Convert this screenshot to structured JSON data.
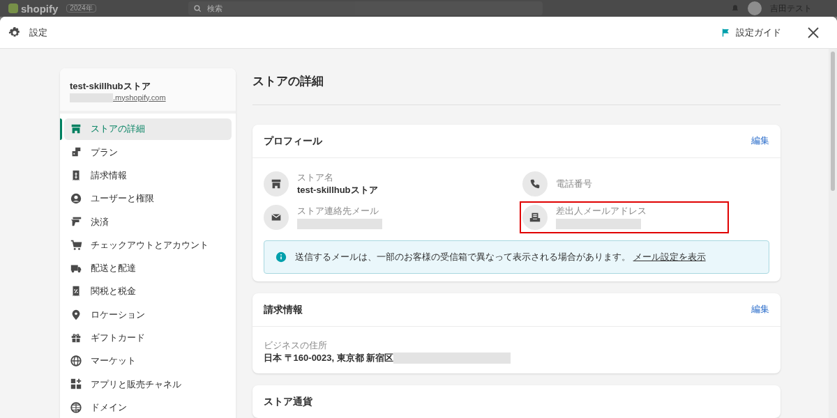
{
  "topbar": {
    "logo": "shopify",
    "badge": "2024年",
    "search": {
      "placeholder": "検索"
    },
    "user": "吉田テスト"
  },
  "window": {
    "title": "設定",
    "guide": "設定ガイド"
  },
  "sidebar": {
    "store_name": "test-skillhubストア",
    "domain": ".myshopify.com",
    "items": [
      {
        "label": "ストアの詳細",
        "kind": "store",
        "selected": true
      },
      {
        "label": "プラン",
        "kind": "plan",
        "selected": false
      },
      {
        "label": "請求情報",
        "kind": "bill",
        "selected": false
      },
      {
        "label": "ユーザーと権限",
        "kind": "user",
        "selected": false
      },
      {
        "label": "決済",
        "kind": "card",
        "selected": false
      },
      {
        "label": "チェックアウトとアカウント",
        "kind": "cart",
        "selected": false
      },
      {
        "label": "配送と配達",
        "kind": "truck",
        "selected": false
      },
      {
        "label": "関税と税金",
        "kind": "tax",
        "selected": false
      },
      {
        "label": "ロケーション",
        "kind": "pin",
        "selected": false
      },
      {
        "label": "ギフトカード",
        "kind": "gift",
        "selected": false
      },
      {
        "label": "マーケット",
        "kind": "globe",
        "selected": false
      },
      {
        "label": "アプリと販売チャネル",
        "kind": "apps",
        "selected": false
      },
      {
        "label": "ドメイン",
        "kind": "domain",
        "selected": false
      }
    ]
  },
  "page": {
    "title": "ストアの詳細",
    "profile": {
      "title": "プロフィール",
      "edit": "編集",
      "fields": [
        {
          "label": "ストア名",
          "value": "test-skillhubストア",
          "kind": "store",
          "highlighted": false
        },
        {
          "label": "電話番号",
          "kind": "phone",
          "highlighted": false
        },
        {
          "label": "ストア連絡先メール",
          "redacted": true,
          "kind": "mail",
          "highlighted": false
        },
        {
          "label": "差出人メールアドレス",
          "redacted": true,
          "kind": "sender",
          "highlighted": true
        }
      ],
      "notice": {
        "text": "送信するメールは、一部のお客様の受信箱で異なって表示される場合があります。",
        "link": "メール設定を表示"
      }
    },
    "billing": {
      "title": "請求情報",
      "edit": "編集",
      "address_label": "ビジネスの住所",
      "address": "日本 〒160-0023, 東京都 新宿区"
    },
    "currency": {
      "title": "ストア通貨"
    }
  }
}
